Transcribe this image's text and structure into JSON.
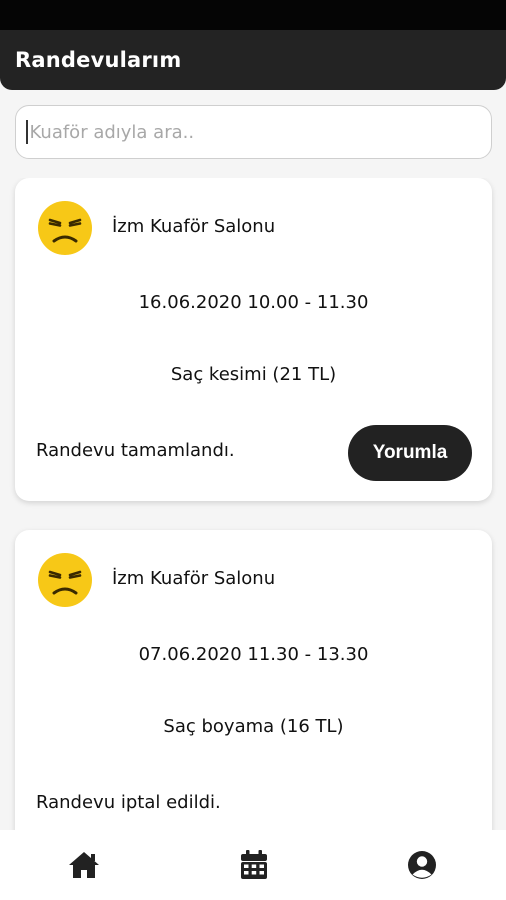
{
  "app_bar": {
    "title": "Randevularım"
  },
  "search": {
    "placeholder": "Kuaför adıyla ara.."
  },
  "appointments": [
    {
      "salon": "İzm Kuaför Salonu",
      "datetime": "16.06.2020 10.00 - 11.30",
      "service": "Saç kesimi (21 TL)",
      "status": "Randevu tamamlandı.",
      "action_label": "Yorumla"
    },
    {
      "salon": "İzm Kuaför Salonu",
      "datetime": "07.06.2020 11.30 - 13.30",
      "service": "Saç boyama (16 TL)",
      "status": "Randevu iptal edildi."
    }
  ],
  "bottom_nav": {
    "items": [
      {
        "icon": "home-icon"
      },
      {
        "icon": "calendar-icon"
      },
      {
        "icon": "user-circle-icon"
      }
    ]
  },
  "colors": {
    "app_bar": "#232323",
    "button": "#222222",
    "emoji_face": "#F7C817",
    "background": "#f5f5f5"
  }
}
